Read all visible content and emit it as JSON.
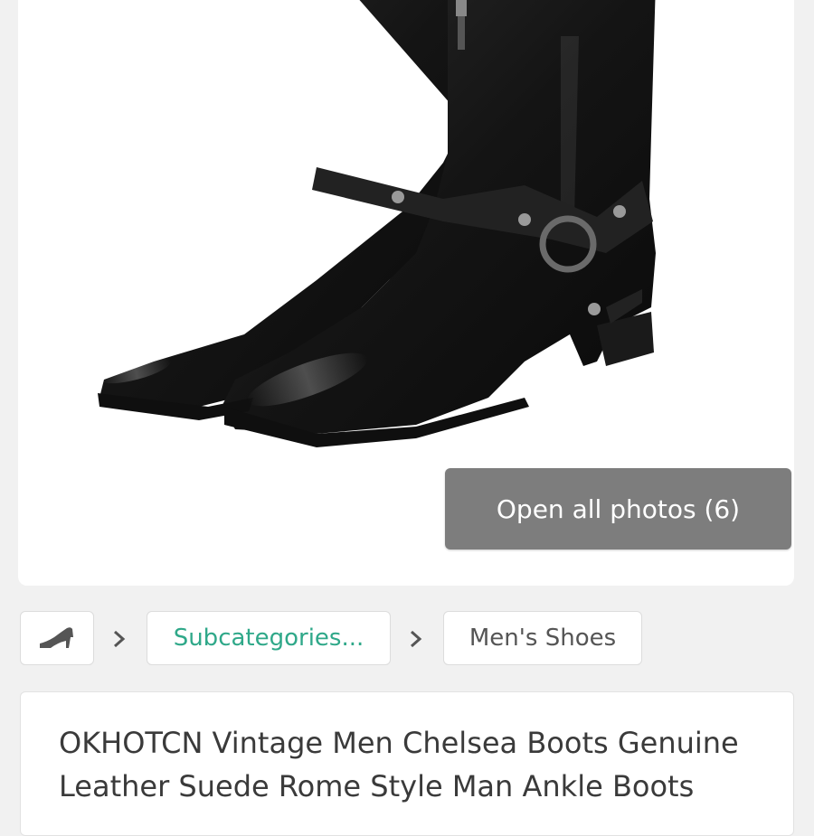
{
  "gallery": {
    "open_all_label": "Open all photos (6)",
    "product_image": "black-harness-boots-photo"
  },
  "breadcrumb": {
    "home_icon": "high-heel-shoe-icon",
    "separator_icon": "chevron-right-icon",
    "subcategories_label": "Subcategories...",
    "category_label": "Men's Shoes",
    "subcategories_color": "#2fa889"
  },
  "product": {
    "title": "OKHOTCN Vintage Men Chelsea Boots Genuine Leather Suede Rome Style Man Ankle Boots"
  }
}
